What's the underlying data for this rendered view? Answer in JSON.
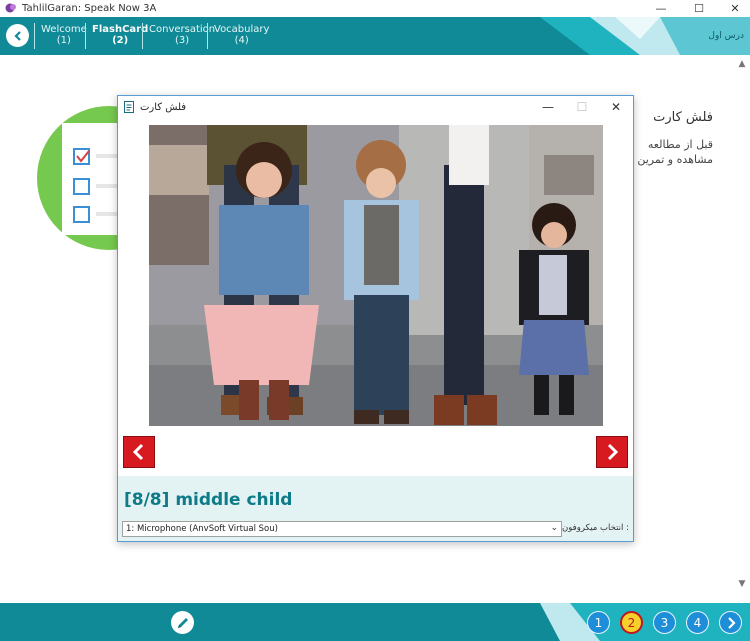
{
  "window": {
    "title": "TahlilGaran: Speak Now 3A",
    "minimize": "—",
    "maximize": "☐",
    "close": "✕"
  },
  "nav": {
    "tabs": [
      {
        "label": "Welcome",
        "num": "(1)"
      },
      {
        "label": "FlashCard",
        "num": "(2)"
      },
      {
        "label": "Conversation",
        "num": "(3)"
      },
      {
        "label": "Vocabulary",
        "num": "(4)"
      }
    ],
    "lesson": "درس اول",
    "active_tab": 1
  },
  "background": {
    "title": "فلش کارت",
    "text_line1": "قبل از مطالعه",
    "text_line2": "مشاهده و تمرین"
  },
  "dialog": {
    "title": "فلش کارت",
    "caption": "[8/8]  middle child",
    "mic_value": "1: Microphone (AnvSoft Virtual Sou)",
    "mic_label": "انتخاب میکروفون :"
  },
  "pager": {
    "pages": [
      "1",
      "2",
      "3",
      "4"
    ],
    "current": "2"
  },
  "colors": {
    "teal": "#0f8a96",
    "accent_red": "#d71920",
    "page_blue": "#1e8ed8",
    "page_active": "#f7d02a",
    "caption_teal": "#0d7b88"
  }
}
